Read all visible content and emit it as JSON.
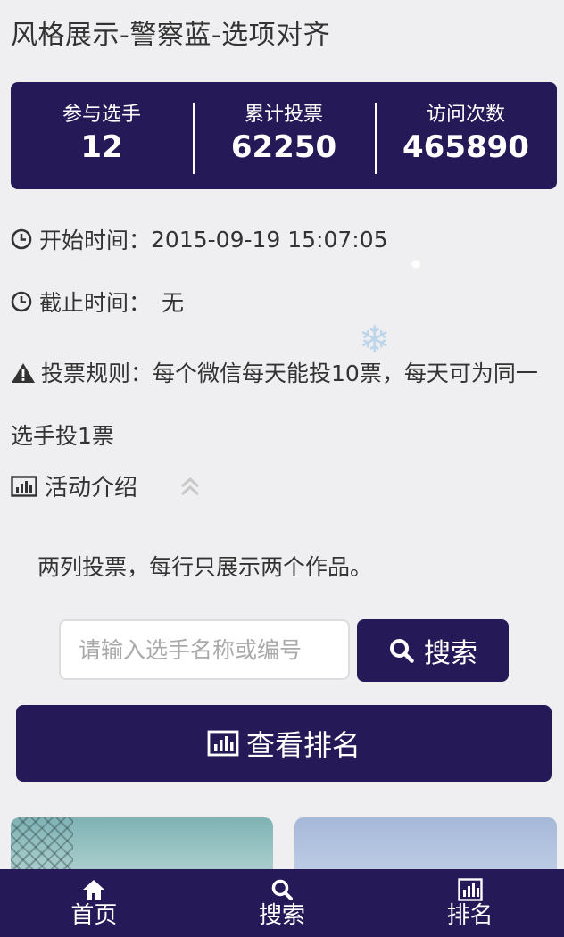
{
  "page_title": "风格展示-警察蓝-选项对齐",
  "stats": [
    {
      "label": "参与选手",
      "value": "12"
    },
    {
      "label": "累计投票",
      "value": "62250"
    },
    {
      "label": "访问次数",
      "value": "465890"
    }
  ],
  "start_time": {
    "label": "开始时间：",
    "value": "2015-09-19 15:07:05"
  },
  "end_time": {
    "label": "截止时间：",
    "value": "无"
  },
  "rules": {
    "label": "投票规则：",
    "text": "每个微信每天能投10票，每天可为同一选手投1票"
  },
  "intro": {
    "toggle_label": "活动介绍",
    "text": "两列投票，每行只展示两个作品。"
  },
  "search": {
    "placeholder": "请输入选手名称或编号",
    "button_label": "搜索"
  },
  "rank_button_label": "查看排名",
  "tabbar": [
    {
      "label": "首页",
      "icon": "home-icon"
    },
    {
      "label": "搜索",
      "icon": "search-icon"
    },
    {
      "label": "排名",
      "icon": "bar-chart-icon"
    }
  ],
  "colors": {
    "primary": "#261958",
    "background": "#efeff1"
  }
}
